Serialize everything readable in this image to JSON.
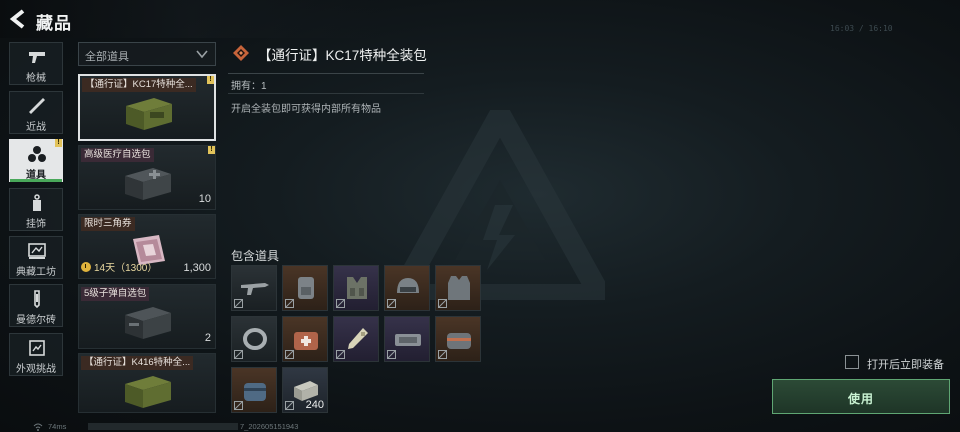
{
  "header": {
    "title": "藏品",
    "coords": "16:03 / 16:10"
  },
  "nav": {
    "items": [
      {
        "label": "枪械",
        "icon": "gun-icon"
      },
      {
        "label": "近战",
        "icon": "knife-icon"
      },
      {
        "label": "道具",
        "icon": "items-icon",
        "active": true,
        "flag": "!"
      },
      {
        "label": "挂饰",
        "icon": "charm-icon"
      },
      {
        "label": "典藏工坊",
        "icon": "workshop-icon"
      },
      {
        "label": "曼德尔砖",
        "icon": "brick-icon"
      },
      {
        "label": "外观挑战",
        "icon": "challenge-icon"
      }
    ]
  },
  "filter": {
    "label": "全部道具"
  },
  "items": [
    {
      "title": "【通行证】KC17特种全...",
      "count": "",
      "flag": "!",
      "selected": true
    },
    {
      "title": "高级医疗自选包",
      "count": "10",
      "flag": "!"
    },
    {
      "title": "限时三角券",
      "count": "1,300",
      "timer": "14天（1300）"
    },
    {
      "title": "5级子弹自选包",
      "count": "2"
    },
    {
      "title": "【通行证】K416特种全...",
      "count": ""
    }
  ],
  "detail": {
    "title": "【通行证】KC17特种全装包",
    "own_label": "拥有：1",
    "description": "开启全装包即可获得内部所有物品",
    "contents_title": "包含道具",
    "slots": [
      {
        "icon": "rifle-icon",
        "rarity": "grey",
        "qty": ""
      },
      {
        "icon": "backpack-icon",
        "rarity": "orange",
        "qty": ""
      },
      {
        "icon": "chest-rig-icon",
        "rarity": "purple",
        "qty": ""
      },
      {
        "icon": "helmet-icon",
        "rarity": "orange",
        "qty": ""
      },
      {
        "icon": "body-armor-icon",
        "rarity": "orange",
        "qty": ""
      },
      {
        "icon": "bandage-icon",
        "rarity": "grey",
        "qty": ""
      },
      {
        "icon": "medkit-icon",
        "rarity": "orange",
        "qty": ""
      },
      {
        "icon": "syringe-icon",
        "rarity": "purple",
        "qty": ""
      },
      {
        "icon": "tool-case-icon",
        "rarity": "purple",
        "qty": ""
      },
      {
        "icon": "medical-bag-icon",
        "rarity": "orange",
        "qty": ""
      },
      {
        "icon": "pouch-icon",
        "rarity": "orange",
        "qty": ""
      },
      {
        "icon": "ammo-box-icon",
        "rarity": "slate",
        "qty": "240"
      }
    ]
  },
  "actions": {
    "auto_equip_label": "打开后立即装备",
    "use_label": "使用"
  },
  "status": {
    "ping": "74ms",
    "build": "7_202605151943"
  },
  "colors": {
    "accent": "#49a85a",
    "flag": "#e2c35a",
    "use_border": "#5fa673"
  }
}
